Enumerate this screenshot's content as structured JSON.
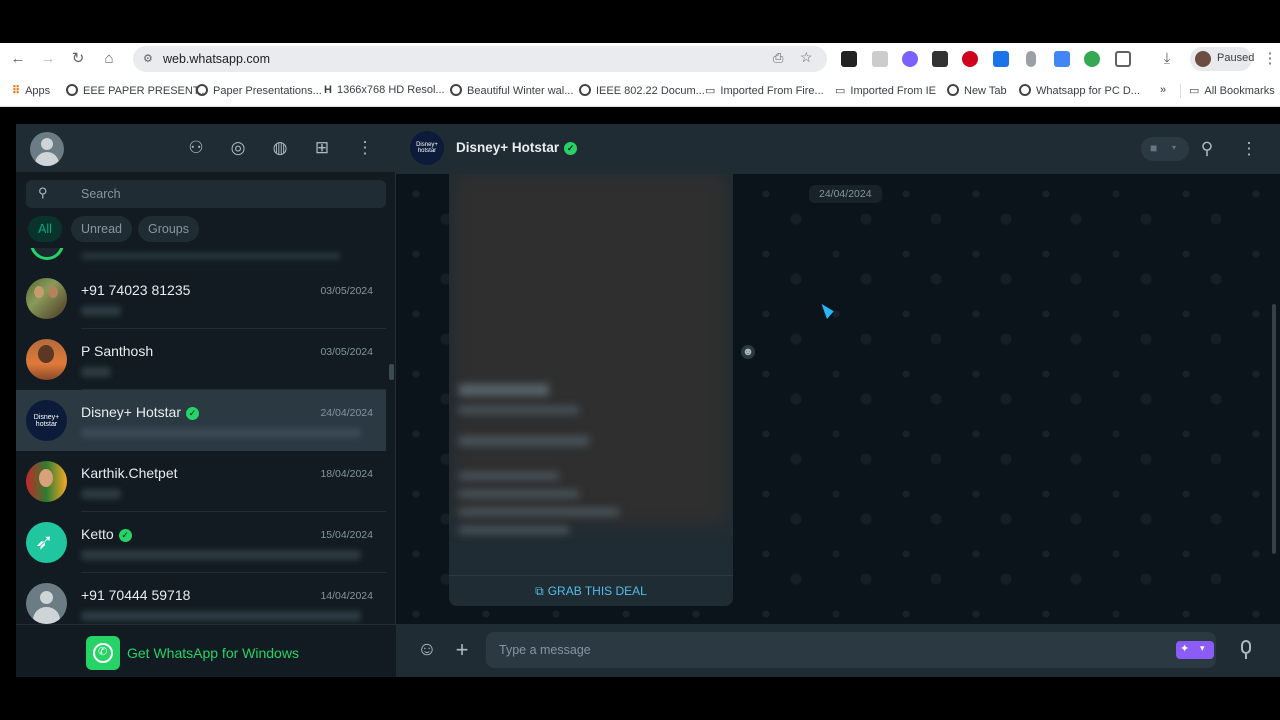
{
  "browser": {
    "url": "web.whatsapp.com",
    "profile_label": "Paused",
    "bookmarks": [
      {
        "label": "Apps"
      },
      {
        "label": "EEE PAPER PRESENT..."
      },
      {
        "label": "Paper Presentations..."
      },
      {
        "label": "1366x768 HD Resol..."
      },
      {
        "label": "Beautiful Winter wal..."
      },
      {
        "label": "IEEE 802.22 Docum..."
      },
      {
        "label": "Imported From Fire..."
      },
      {
        "label": "Imported From IE"
      },
      {
        "label": "New Tab"
      },
      {
        "label": "Whatsapp for PC D..."
      },
      {
        "label": "All Bookmarks"
      }
    ]
  },
  "sidebar": {
    "search_placeholder": "Search",
    "filters": [
      "All",
      "Unread",
      "Groups"
    ],
    "chats": [
      {
        "name": "+91 74023 81235",
        "date": "03/05/2024",
        "verified": false
      },
      {
        "name": "P Santhosh",
        "date": "03/05/2024",
        "verified": false
      },
      {
        "name": "Disney+ Hotstar",
        "date": "24/04/2024",
        "verified": true
      },
      {
        "name": "Karthik.Chetpet",
        "date": "18/04/2024",
        "verified": false
      },
      {
        "name": "Ketto",
        "date": "15/04/2024",
        "verified": true
      },
      {
        "name": "+91 70444 59718",
        "date": "14/04/2024",
        "verified": false
      }
    ],
    "promo": "Get WhatsApp for Windows"
  },
  "conversation": {
    "title": "Disney+ Hotstar",
    "avatar_text": "Disney+ hotstar",
    "date_chip": "24/04/2024",
    "cta": "GRAB THIS DEAL",
    "composer_placeholder": "Type a message"
  },
  "colors": {
    "accent": "#25d366",
    "panel": "#202c33",
    "bg": "#111b21",
    "cta": "#53bdeb"
  }
}
